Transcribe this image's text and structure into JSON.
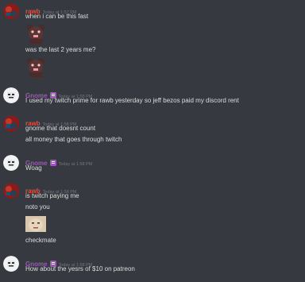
{
  "messages": [
    {
      "author": "rawb",
      "timestamp": "Today at 1:57 PM",
      "lines": [
        "when i can be this fast",
        "was the last 2 years me?"
      ],
      "emotes": [
        "bear-emote",
        "bear-emote"
      ]
    },
    {
      "author": "Gnome",
      "timestamp": "Today at 1:58 PM",
      "lines": [
        "I used my twitch prime for rawb yesterday so jeff bezos paid my discord rent"
      ]
    },
    {
      "author": "rawb",
      "timestamp": "Today at 1:58 PM",
      "lines": [
        "gnome that doesnt count",
        "all money that goes through twitch"
      ]
    },
    {
      "author": "Gnome",
      "timestamp": "Today at 1:58 PM",
      "lines": [
        "Woag"
      ]
    },
    {
      "author": "rawb",
      "timestamp": "Today at 1:58 PM",
      "lines": [
        "is twitch paying me",
        "noto you",
        "checkmate"
      ],
      "attachment": "face-image"
    },
    {
      "author": "Gnome",
      "timestamp": "Today at 1:58 PM",
      "lines": [
        "How about the yesrs of $10 on patreon"
      ]
    }
  ],
  "colors": {
    "background": "#36393f",
    "rawb_name": "#e74c3c",
    "gnome_name": "#9b59b6",
    "timestamp": "#72767d",
    "text": "#dcddde"
  }
}
